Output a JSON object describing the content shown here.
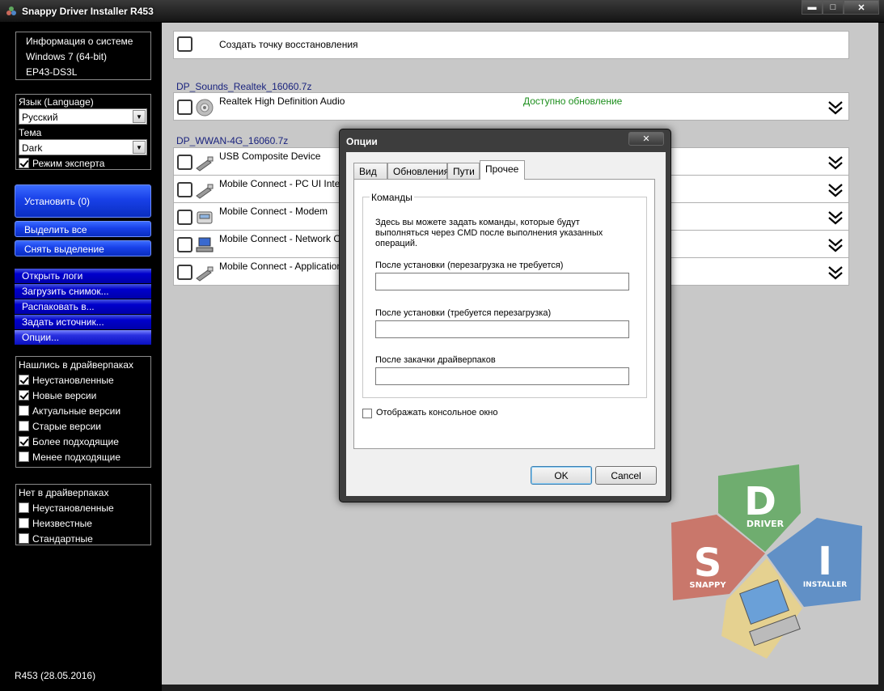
{
  "window": {
    "title": "Snappy Driver Installer R453",
    "minimize_label": "▬",
    "maximize_label": "□",
    "close_label": "✕"
  },
  "sysinfo": {
    "label": "Информация о системе",
    "os": "Windows 7 (64-bit)",
    "board": "EP43-DS3L"
  },
  "settings": {
    "language_label": "Язык (Language)",
    "language_value": "Русский",
    "theme_label": "Тема",
    "theme_value": "Dark",
    "expert_mode_label": "Режим эксперта",
    "expert_mode_checked": true
  },
  "actions": {
    "install": "Установить (0)",
    "select_all": "Выделить все",
    "deselect_all": "Снять выделение"
  },
  "menu": {
    "open_logs": "Открыть логи",
    "load_snapshot": "Загрузить снимок...",
    "extract_to": "Распаковать в...",
    "set_source": "Задать источник...",
    "options": "Опции..."
  },
  "filters_found": {
    "title": "Нашлись в драйверпаках",
    "items": [
      {
        "label": "Неустановленные",
        "checked": true
      },
      {
        "label": "Новые версии",
        "checked": true
      },
      {
        "label": "Актуальные версии",
        "checked": false
      },
      {
        "label": "Старые версии",
        "checked": false
      },
      {
        "label": "Более подходящие",
        "checked": true
      },
      {
        "label": "Менее подходящие",
        "checked": false
      }
    ]
  },
  "filters_missing": {
    "title": "Нет в драйверпаках",
    "items": [
      {
        "label": "Неустановленные",
        "checked": false
      },
      {
        "label": "Неизвестные",
        "checked": false
      },
      {
        "label": "Стандартные",
        "checked": false
      }
    ]
  },
  "version": "R453 (28.05.2016)",
  "main": {
    "restore_point": "Создать точку восстановления",
    "packs": [
      {
        "name": "DP_Sounds_Realtek_16060.7z",
        "devices": [
          {
            "name": "Realtek High Definition Audio",
            "status": "Доступно обновление",
            "icon": "audio-icon"
          }
        ]
      },
      {
        "name": "DP_WWAN-4G_16060.7z",
        "devices": [
          {
            "name": "USB Composite Device",
            "icon": "usb-icon"
          },
          {
            "name": "Mobile Connect - PC UI Inte",
            "icon": "usb-icon"
          },
          {
            "name": "Mobile Connect - Modem",
            "icon": "modem-icon"
          },
          {
            "name": "Mobile Connect - Network C",
            "icon": "network-icon"
          },
          {
            "name": "Mobile Connect - Application",
            "icon": "usb-icon"
          }
        ]
      }
    ]
  },
  "logo": {
    "d_letter": "D",
    "d_word": "DRIVER",
    "s_letter": "S",
    "s_word": "SNAPPY",
    "i_letter": "I",
    "i_word": "INSTALLER",
    "colors": {
      "green": "#5fa85f",
      "red": "#c9685a",
      "blue": "#4f86c6"
    }
  },
  "dialog": {
    "title": "Опции",
    "close_label": "✕",
    "tabs": [
      "Вид",
      "Обновления",
      "Пути",
      "Прочее"
    ],
    "active_tab": "Прочее",
    "group_title": "Команды",
    "description_line1": "Здесь вы можете задать команды, которые будут",
    "description_line2": "выполняться через CMD после выполнения указанных",
    "description_line3": "операций.",
    "field1_label": "После установки (перезагрузка не требуется)",
    "field1_value": "",
    "field2_label": "После установки (требуется перезагрузка)",
    "field2_value": "",
    "field3_label": "После закачки драйверпаков",
    "field3_value": "",
    "console_label": "Отображать консольное окно",
    "console_checked": false,
    "ok": "OK",
    "cancel": "Cancel"
  }
}
